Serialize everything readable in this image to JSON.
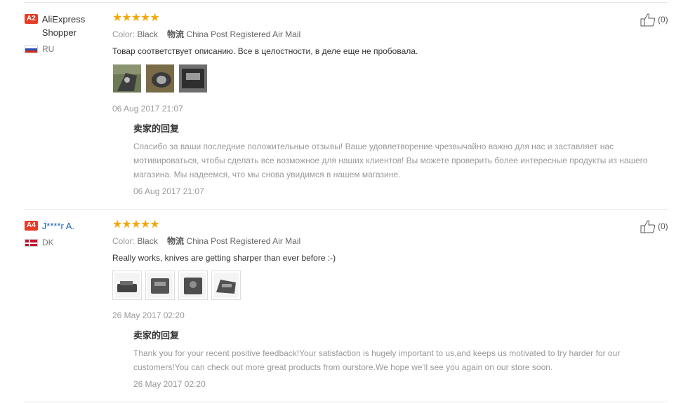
{
  "reviews": [
    {
      "level": "A2",
      "username": "AliExpress Shopper",
      "country": "RU",
      "rating": 5,
      "stars": "★★★★★",
      "color_label": "Color:",
      "color_value": "Black",
      "shipping_label": "物流",
      "shipping_value": "China Post Registered Air Mail",
      "text": "Товар соответствует описанию. Все в целостности, в деле еще не пробовала.",
      "photo_count": 3,
      "date": "06 Aug 2017 21:07",
      "reply_title": "卖家的回复",
      "reply_text": "Спасибо за ваши последние положительные отзывы! Ваше удовлетворение чрезвычайно важно для нас и заставляет нас мотивироваться, чтобы сделать все возможное для наших клиентов! Вы можете проверить более интересные продукты из нашего магазина. Мы надеемся, что мы снова увидимся в нашем магазине.",
      "reply_date": "06 Aug 2017 21:07",
      "helpful_count": "(0)"
    },
    {
      "level": "A4",
      "username": "J****r A.",
      "country": "DK",
      "rating": 5,
      "stars": "★★★★★",
      "color_label": "Color:",
      "color_value": "Black",
      "shipping_label": "物流",
      "shipping_value": "China Post Registered Air Mail",
      "text": "Really works, knives are getting sharper than ever before :-)",
      "photo_count": 4,
      "date": "26 May 2017 02:20",
      "reply_title": "卖家的回复",
      "reply_text": "Thank you for your recent positive feedback!Your satisfaction is hugely important to us,and keeps us motivated to try harder for our customers!You can check out more great products from ourstore.We hope we'll see you again on our store soon.",
      "reply_date": "26 May 2017 02:20",
      "helpful_count": "(0)"
    }
  ],
  "colors": {
    "badge": "#e53c28",
    "star": "#f2a80b",
    "link": "#1a62b8"
  },
  "icons": {
    "helpful": "thumbs-up-icon",
    "flag_ru": "flag-ru-icon",
    "flag_dk": "flag-dk-icon"
  }
}
